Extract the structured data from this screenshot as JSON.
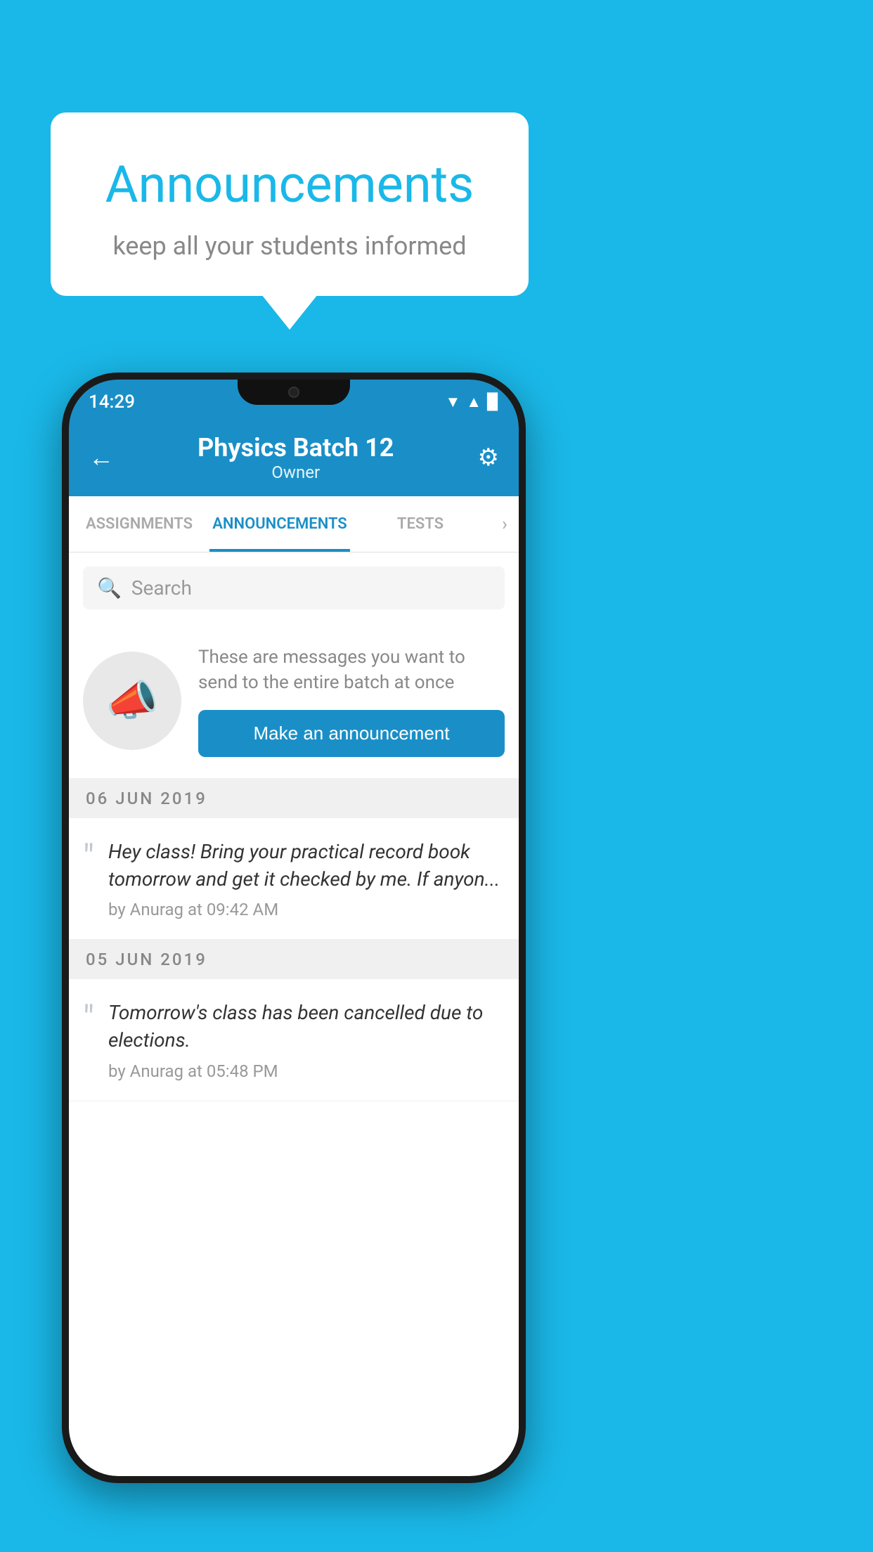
{
  "background_color": "#1ab8e8",
  "speech_bubble": {
    "title": "Announcements",
    "subtitle": "keep all your students informed"
  },
  "phone": {
    "status_bar": {
      "time": "14:29",
      "wifi": "▲",
      "signal": "▲",
      "battery": "▉"
    },
    "header": {
      "title": "Physics Batch 12",
      "subtitle": "Owner",
      "back_label": "←",
      "gear_label": "⚙"
    },
    "tabs": [
      {
        "label": "ASSIGNMENTS",
        "active": false
      },
      {
        "label": "ANNOUNCEMENTS",
        "active": true
      },
      {
        "label": "TESTS",
        "active": false
      }
    ],
    "search": {
      "placeholder": "Search"
    },
    "promo": {
      "description": "These are messages you want to send to the entire batch at once",
      "button_label": "Make an announcement"
    },
    "announcements": [
      {
        "date": "06  JUN  2019",
        "text": "Hey class! Bring your practical record book tomorrow and get it checked by me. If anyon...",
        "meta": "by Anurag at 09:42 AM"
      },
      {
        "date": "05  JUN  2019",
        "text": "Tomorrow's class has been cancelled due to elections.",
        "meta": "by Anurag at 05:48 PM"
      }
    ]
  }
}
